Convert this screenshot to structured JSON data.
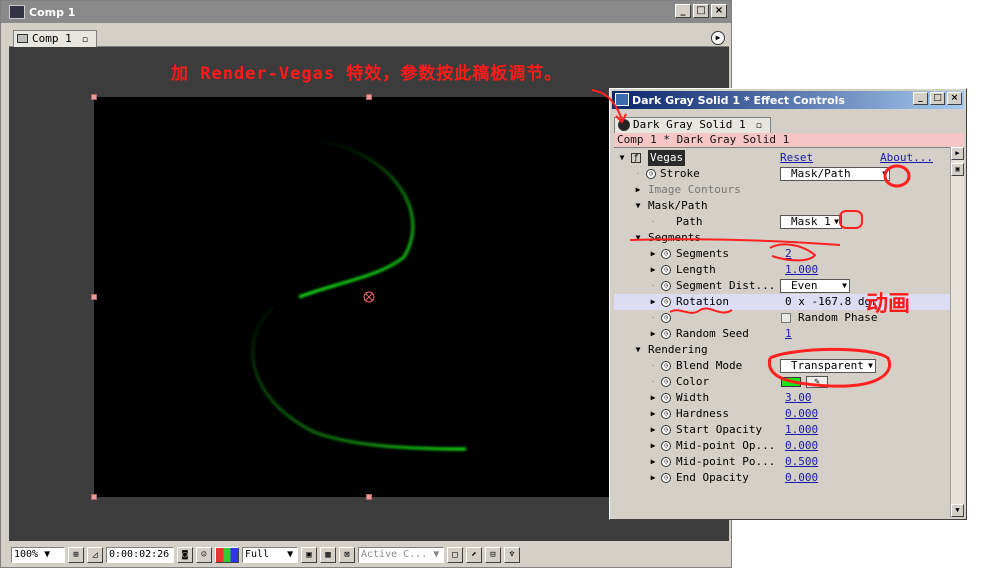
{
  "comp_window": {
    "title": "Comp 1",
    "tab_label": "Comp 1",
    "annotation": "加 Render-Vegas 特效，参数按此稿板调节。",
    "statusbar": {
      "zoom": "100%",
      "timecode": "0:00:02:26",
      "resolution": "Full",
      "camera": "Active C..."
    }
  },
  "effect_controls": {
    "title": "Dark Gray Solid 1 * Effect Controls",
    "tab_label": "Dark Gray Solid 1",
    "layer_path": "Comp 1 * Dark Gray Solid 1",
    "effect_name": "Vegas",
    "reset_label": "Reset",
    "about_label": "About...",
    "params": {
      "stroke": {
        "label": "Stroke",
        "value": "Mask/Path"
      },
      "image_contours": {
        "label": "Image Contours"
      },
      "mask_path_group": {
        "label": "Mask/Path"
      },
      "path": {
        "label": "Path",
        "value": "Mask 1"
      },
      "segments_group": {
        "label": "Segments"
      },
      "segments": {
        "label": "Segments",
        "value": "2"
      },
      "length": {
        "label": "Length",
        "value": "1.000"
      },
      "segment_distribution": {
        "label": "Segment Dist...",
        "value": "Even"
      },
      "rotation": {
        "label": "Rotation",
        "value": "0 x -167.8 dgr"
      },
      "random_phase": {
        "label": "Random Phase"
      },
      "random_seed": {
        "label": "Random Seed",
        "value": "1"
      },
      "rendering_group": {
        "label": "Rendering"
      },
      "blend_mode": {
        "label": "Blend Mode",
        "value": "Transparent"
      },
      "color": {
        "label": "Color",
        "value_hex": "#19e619"
      },
      "width": {
        "label": "Width",
        "value": "3.00"
      },
      "hardness": {
        "label": "Hardness",
        "value": "0.000"
      },
      "start_opacity": {
        "label": "Start Opacity",
        "value": "1.000"
      },
      "midpoint_opacity": {
        "label": "Mid-point Op...",
        "value": "0.000"
      },
      "midpoint_position": {
        "label": "Mid-point Po...",
        "value": "0.500"
      },
      "end_opacity": {
        "label": "End Opacity",
        "value": "0.000"
      }
    },
    "side_annotation": "动画"
  },
  "colors": {
    "stroke_green": "#19e619",
    "annotation_red": "#ff1a1a",
    "title_blue": "#0a246a"
  }
}
